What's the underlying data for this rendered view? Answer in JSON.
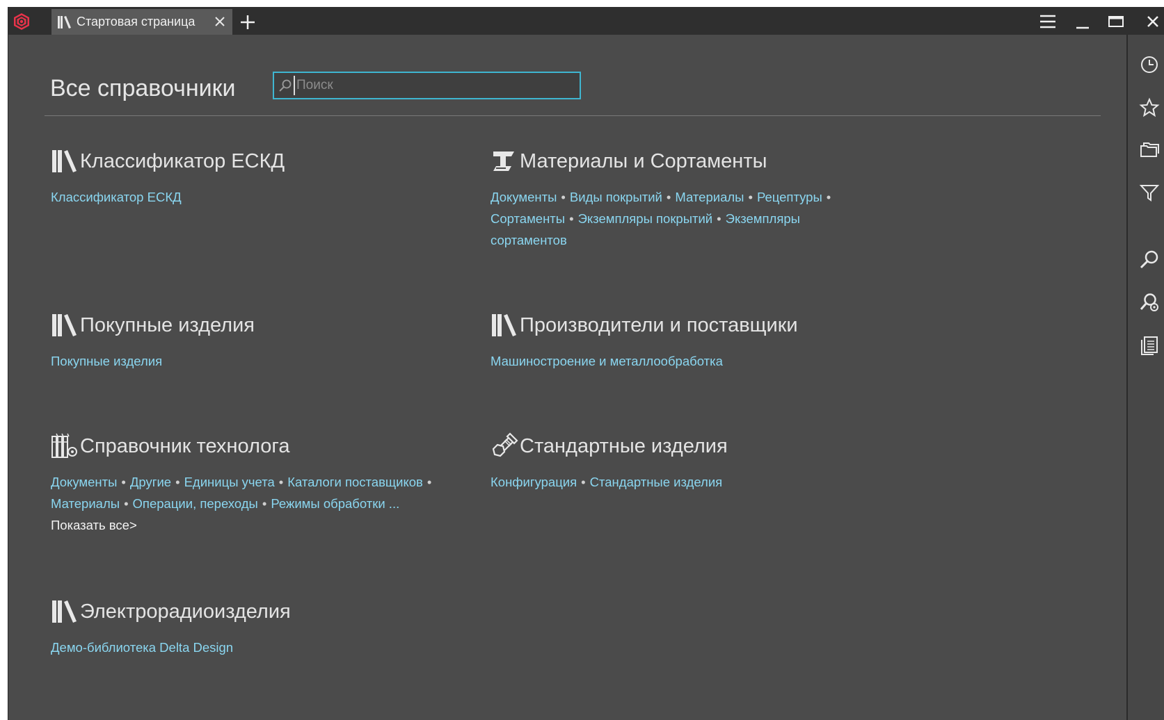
{
  "window": {
    "tab_label": "Стартовая страница"
  },
  "main": {
    "title": "Все справочники",
    "search_placeholder": "Поиск"
  },
  "sections": [
    {
      "title": "Классификатор ЕСКД",
      "icon": "library-books-icon",
      "links": [
        "Классификатор ЕСКД"
      ]
    },
    {
      "title": "Материалы и Сортаменты",
      "icon": "i-beam-icon",
      "links": [
        "Документы",
        "Виды покрытий",
        "Материалы",
        "Рецептуры",
        "Сортаменты",
        "Экземпляры покрытий",
        "Экземпляры сортаментов"
      ]
    },
    {
      "title": "Покупные изделия",
      "icon": "library-books-icon",
      "links": [
        "Покупные изделия"
      ]
    },
    {
      "title": "Производители и поставщики",
      "icon": "library-books-icon",
      "links": [
        "Машиностроение и металлообработка"
      ]
    },
    {
      "title": "Справочник технолога",
      "icon": "technologist-books-icon",
      "links": [
        "Документы",
        "Другие",
        "Единицы учета",
        "Каталоги поставщиков",
        "Материалы",
        "Операции, переходы",
        "Режимы обработки ..."
      ],
      "show_all": "Показать все>"
    },
    {
      "title": "Стандартные изделия",
      "icon": "bolt-nut-icon",
      "links": [
        "Конфигурация",
        "Стандартные изделия"
      ]
    },
    {
      "title": "Электрорадиоизделия",
      "icon": "library-books-icon",
      "links": [
        "Демо-библиотека Delta Design"
      ]
    }
  ],
  "colors": {
    "background": "#4b4b4b",
    "titlebar": "#2f2f2f",
    "link": "#8ad6f0",
    "search_border": "#3fb6d1",
    "logo": "#e8334a"
  }
}
